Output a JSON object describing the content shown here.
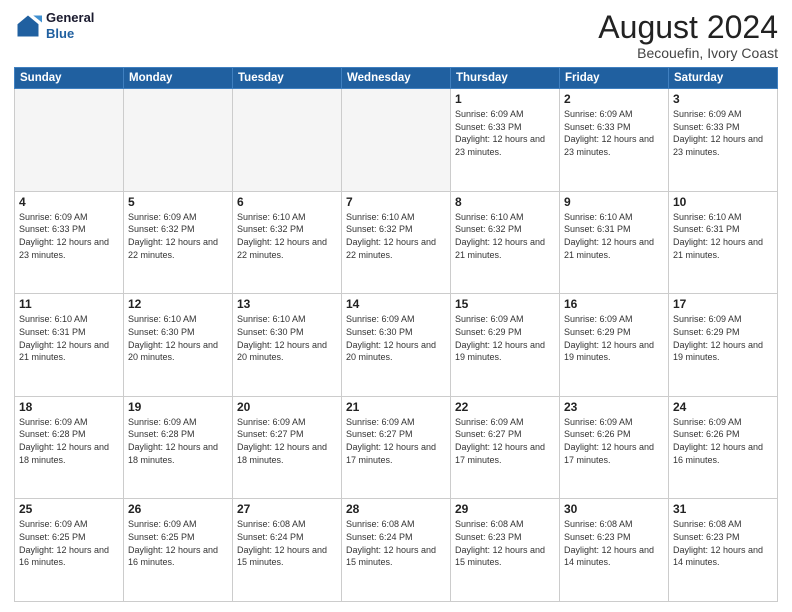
{
  "header": {
    "logo_line1": "General",
    "logo_line2": "Blue",
    "main_title": "August 2024",
    "subtitle": "Becouefin, Ivory Coast"
  },
  "days_of_week": [
    "Sunday",
    "Monday",
    "Tuesday",
    "Wednesday",
    "Thursday",
    "Friday",
    "Saturday"
  ],
  "weeks": [
    [
      {
        "day": "",
        "empty": true
      },
      {
        "day": "",
        "empty": true
      },
      {
        "day": "",
        "empty": true
      },
      {
        "day": "",
        "empty": true
      },
      {
        "day": "1",
        "sunrise": "6:09 AM",
        "sunset": "6:33 PM",
        "daylight": "12 hours and 23 minutes."
      },
      {
        "day": "2",
        "sunrise": "6:09 AM",
        "sunset": "6:33 PM",
        "daylight": "12 hours and 23 minutes."
      },
      {
        "day": "3",
        "sunrise": "6:09 AM",
        "sunset": "6:33 PM",
        "daylight": "12 hours and 23 minutes."
      }
    ],
    [
      {
        "day": "4",
        "sunrise": "6:09 AM",
        "sunset": "6:33 PM",
        "daylight": "12 hours and 23 minutes."
      },
      {
        "day": "5",
        "sunrise": "6:09 AM",
        "sunset": "6:32 PM",
        "daylight": "12 hours and 22 minutes."
      },
      {
        "day": "6",
        "sunrise": "6:10 AM",
        "sunset": "6:32 PM",
        "daylight": "12 hours and 22 minutes."
      },
      {
        "day": "7",
        "sunrise": "6:10 AM",
        "sunset": "6:32 PM",
        "daylight": "12 hours and 22 minutes."
      },
      {
        "day": "8",
        "sunrise": "6:10 AM",
        "sunset": "6:32 PM",
        "daylight": "12 hours and 21 minutes."
      },
      {
        "day": "9",
        "sunrise": "6:10 AM",
        "sunset": "6:31 PM",
        "daylight": "12 hours and 21 minutes."
      },
      {
        "day": "10",
        "sunrise": "6:10 AM",
        "sunset": "6:31 PM",
        "daylight": "12 hours and 21 minutes."
      }
    ],
    [
      {
        "day": "11",
        "sunrise": "6:10 AM",
        "sunset": "6:31 PM",
        "daylight": "12 hours and 21 minutes."
      },
      {
        "day": "12",
        "sunrise": "6:10 AM",
        "sunset": "6:30 PM",
        "daylight": "12 hours and 20 minutes."
      },
      {
        "day": "13",
        "sunrise": "6:10 AM",
        "sunset": "6:30 PM",
        "daylight": "12 hours and 20 minutes."
      },
      {
        "day": "14",
        "sunrise": "6:09 AM",
        "sunset": "6:30 PM",
        "daylight": "12 hours and 20 minutes."
      },
      {
        "day": "15",
        "sunrise": "6:09 AM",
        "sunset": "6:29 PM",
        "daylight": "12 hours and 19 minutes."
      },
      {
        "day": "16",
        "sunrise": "6:09 AM",
        "sunset": "6:29 PM",
        "daylight": "12 hours and 19 minutes."
      },
      {
        "day": "17",
        "sunrise": "6:09 AM",
        "sunset": "6:29 PM",
        "daylight": "12 hours and 19 minutes."
      }
    ],
    [
      {
        "day": "18",
        "sunrise": "6:09 AM",
        "sunset": "6:28 PM",
        "daylight": "12 hours and 18 minutes."
      },
      {
        "day": "19",
        "sunrise": "6:09 AM",
        "sunset": "6:28 PM",
        "daylight": "12 hours and 18 minutes."
      },
      {
        "day": "20",
        "sunrise": "6:09 AM",
        "sunset": "6:27 PM",
        "daylight": "12 hours and 18 minutes."
      },
      {
        "day": "21",
        "sunrise": "6:09 AM",
        "sunset": "6:27 PM",
        "daylight": "12 hours and 17 minutes."
      },
      {
        "day": "22",
        "sunrise": "6:09 AM",
        "sunset": "6:27 PM",
        "daylight": "12 hours and 17 minutes."
      },
      {
        "day": "23",
        "sunrise": "6:09 AM",
        "sunset": "6:26 PM",
        "daylight": "12 hours and 17 minutes."
      },
      {
        "day": "24",
        "sunrise": "6:09 AM",
        "sunset": "6:26 PM",
        "daylight": "12 hours and 16 minutes."
      }
    ],
    [
      {
        "day": "25",
        "sunrise": "6:09 AM",
        "sunset": "6:25 PM",
        "daylight": "12 hours and 16 minutes."
      },
      {
        "day": "26",
        "sunrise": "6:09 AM",
        "sunset": "6:25 PM",
        "daylight": "12 hours and 16 minutes."
      },
      {
        "day": "27",
        "sunrise": "6:08 AM",
        "sunset": "6:24 PM",
        "daylight": "12 hours and 15 minutes."
      },
      {
        "day": "28",
        "sunrise": "6:08 AM",
        "sunset": "6:24 PM",
        "daylight": "12 hours and 15 minutes."
      },
      {
        "day": "29",
        "sunrise": "6:08 AM",
        "sunset": "6:23 PM",
        "daylight": "12 hours and 15 minutes."
      },
      {
        "day": "30",
        "sunrise": "6:08 AM",
        "sunset": "6:23 PM",
        "daylight": "12 hours and 14 minutes."
      },
      {
        "day": "31",
        "sunrise": "6:08 AM",
        "sunset": "6:23 PM",
        "daylight": "12 hours and 14 minutes."
      }
    ]
  ],
  "labels": {
    "sunrise": "Sunrise:",
    "sunset": "Sunset:",
    "daylight": "Daylight:"
  }
}
